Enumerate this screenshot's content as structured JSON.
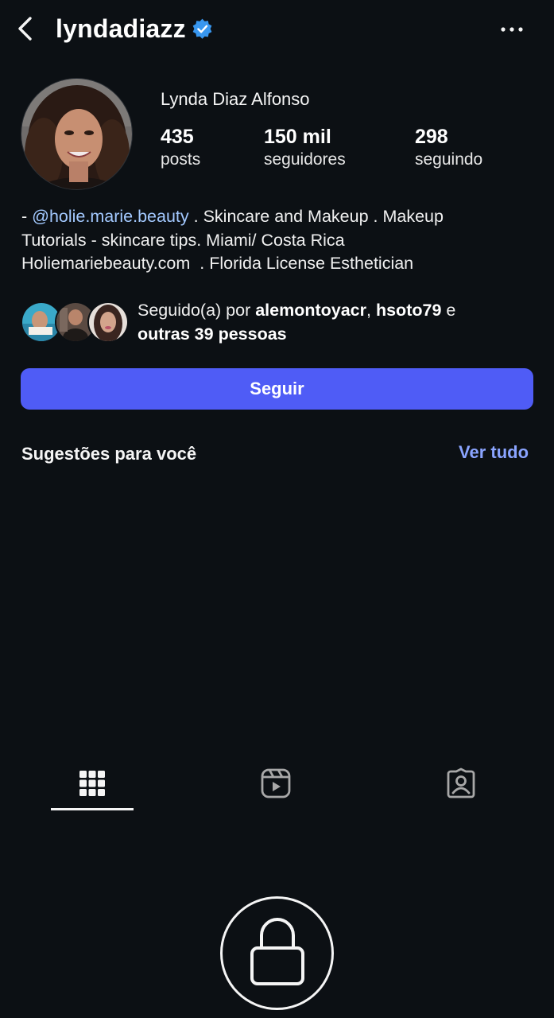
{
  "header": {
    "username": "lyndadiazz",
    "icons": [
      "chevron-left-icon",
      "verified-badge-icon",
      "more-horizontal-icon"
    ]
  },
  "profile": {
    "full_name": "Lynda Diaz Alfonso",
    "stats": {
      "posts": {
        "value": "435",
        "label": "posts"
      },
      "followers": {
        "value": "150 mil",
        "label": "seguidores"
      },
      "following": {
        "value": "298",
        "label": "seguindo"
      }
    },
    "bio": {
      "prefix": "- ",
      "mention": "@holie.marie.beauty",
      "line1_rest": " . Skincare and Makeup . Makeup",
      "line2": "Tutorials - skincare tips. Miami/ Costa Rica",
      "line3": "Holiemariebeauty.com  . Florida License Esthetician"
    },
    "followed_by": {
      "prefix": "Seguido(a) por ",
      "user1": "alemontoyacr",
      "sep": ", ",
      "user2": "hsoto79",
      "and": " e",
      "others": "outras 39 pessoas"
    }
  },
  "actions": {
    "follow_label": "Seguir"
  },
  "suggestions": {
    "title": "Sugestões para você",
    "see_all": "Ver tudo"
  },
  "tabs": [
    {
      "name": "posts-grid",
      "icon": "grid-icon",
      "active": true
    },
    {
      "name": "reels",
      "icon": "reels-icon",
      "active": false
    },
    {
      "name": "tagged",
      "icon": "tagged-person-icon",
      "active": false
    }
  ],
  "private_account": {
    "icon": "lock-icon"
  },
  "colors": {
    "background": "#0c1014",
    "accent_button": "#4f5cf6",
    "link": "#8aa4ff",
    "mention": "#a3c9ff",
    "verified": "#3897f0"
  }
}
